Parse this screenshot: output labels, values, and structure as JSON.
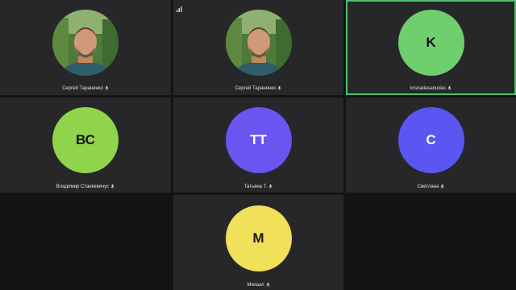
{
  "participants": [
    {
      "name": "Сергей Тараненко",
      "avatar": "photo",
      "icon": "mic-muted-icon"
    },
    {
      "name": "Сергей Тараненко",
      "avatar": "photo",
      "icon": "mic-muted-icon"
    },
    {
      "name": "krsnadasanudas",
      "initials": "K",
      "color": "#6fcf6f",
      "active": true,
      "icon": "mic-muted-icon"
    },
    {
      "name": "Владимир Станкевичус",
      "initials": "ВС",
      "color": "#8fd44a",
      "icon": "mic-muted-icon"
    },
    {
      "name": "Татьяна Т.",
      "initials": "ТТ",
      "color": "#6a55f0",
      "icon": "mic-muted-icon"
    },
    {
      "name": "Светлана",
      "initials": "С",
      "color": "#5b55f2",
      "icon": "mic-muted-icon"
    },
    {
      "name": "Михаэл",
      "initials": "М",
      "color": "#f0e05a",
      "icon": "mic-muted-icon"
    }
  ],
  "colors": {
    "background": "#141416",
    "tile": "#27272a",
    "active_border": "#4cc36b"
  }
}
